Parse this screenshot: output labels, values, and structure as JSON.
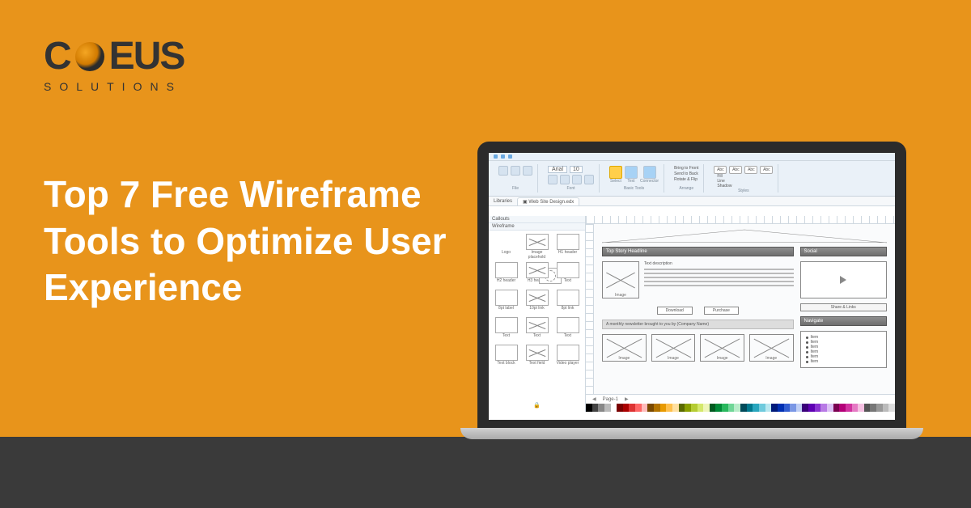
{
  "brand": {
    "name_left": "C",
    "name_right": "EUS",
    "tagline": "SOLUTIONS"
  },
  "headline": "Top 7 Free Wireframe Tools to Optimize User Experience",
  "app": {
    "ribbon": {
      "font_name": "Arial",
      "font_size": "10",
      "groups": {
        "file": "File",
        "font": "Font",
        "basic_tools": "Basic Tools",
        "arrange": "Arrange",
        "styles": "Styles"
      },
      "tools": {
        "select": "Select",
        "text": "Text",
        "connector": "Connector"
      },
      "arrange": {
        "bring_front": "Bring to Front",
        "send_back": "Send to Back",
        "rotate_flip": "Rotate & Flip"
      },
      "style_swatch": "Abc",
      "styles_extra": {
        "fill": "Fill",
        "line": "Line",
        "shadow": "Shadow"
      }
    },
    "doc_tabs": {
      "libraries": "Libraries",
      "file": "Web Site Design.edx"
    },
    "library": {
      "title": "Libraries",
      "section_callouts": "Callouts",
      "section_wireframe": "Wireframe",
      "items": [
        "Logo",
        "Image placehold",
        "H1 header",
        "H2 header",
        "H3 header",
        "Text",
        "8pt label",
        "10pt link",
        "8pt link",
        "Text",
        "Text",
        "Text",
        "Text block",
        "Text field",
        "Video player"
      ]
    },
    "canvas": {
      "top_story": "Top Story Headline",
      "text_desc": "Text description",
      "img_label": "Image",
      "download": "Download",
      "purchase": "Purchase",
      "newsletter": "A monthly newsletter brought to you by (Company Name)",
      "social": "Social",
      "share_links": "Share & Links",
      "navigate": "Navigate",
      "nav_items": [
        "Item",
        "Item",
        "Item",
        "Item",
        "Item",
        "Item"
      ]
    },
    "page_indicator": "Page-1"
  },
  "colors": {
    "swatches": [
      "#000",
      "#444",
      "#888",
      "#bbb",
      "#fff",
      "#7a0000",
      "#a00",
      "#d33",
      "#f66",
      "#fbb",
      "#7a4a00",
      "#b37400",
      "#e89a00",
      "#ffc04d",
      "#ffe0a0",
      "#5a6a00",
      "#8aa000",
      "#b5cc33",
      "#d4e86c",
      "#eef5b8",
      "#005a20",
      "#008a38",
      "#29b85e",
      "#6fd697",
      "#b8ecc9",
      "#004a5a",
      "#00788e",
      "#29a6be",
      "#6fcadd",
      "#b8e7f0",
      "#001a7a",
      "#0030b3",
      "#335ed1",
      "#7a97e5",
      "#c0cff5",
      "#3a007a",
      "#5e00b3",
      "#8a33d1",
      "#b87ae5",
      "#dcc0f5",
      "#7a0050",
      "#b30078",
      "#d133a0",
      "#e57ac4",
      "#f5c0e2",
      "#555",
      "#777",
      "#999",
      "#bbb",
      "#ddd"
    ]
  }
}
